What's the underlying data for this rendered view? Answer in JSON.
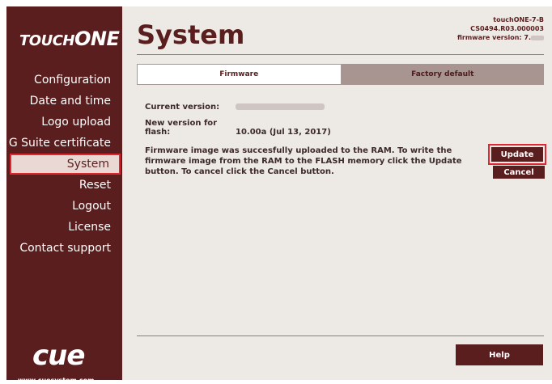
{
  "sidebar": {
    "logo_touch": "TOUCH",
    "logo_one": "ONE",
    "items": [
      {
        "label": "Configuration"
      },
      {
        "label": "Date and time"
      },
      {
        "label": "Logo upload"
      },
      {
        "label": "G Suite certificate"
      },
      {
        "label": "System"
      },
      {
        "label": "Reset"
      },
      {
        "label": "Logout"
      },
      {
        "label": "License"
      },
      {
        "label": "Contact support"
      }
    ],
    "cue_logo": "cue",
    "website": "www.cuesystem.com"
  },
  "header": {
    "title": "System",
    "device_name": "touchONE-7-B",
    "serial": "CS0494.R03.000003",
    "firmware_label": "firmware version: 7."
  },
  "tabs": [
    {
      "label": "Firmware",
      "active": true
    },
    {
      "label": "Factory default",
      "active": false
    }
  ],
  "firmware": {
    "current_version_label": "Current version:",
    "new_version_label": "New version for flash:",
    "new_version_value": "10.00a (Jul 13, 2017)",
    "message": "Firmware image was succesfully uploaded to the RAM. To write the firmware image from the RAM to the FLASH memory click the Update button. To cancel click the Cancel button."
  },
  "buttons": {
    "update": "Update",
    "cancel": "Cancel",
    "help": "Help"
  },
  "colors": {
    "brand": "#5a1e1e",
    "panel": "#ede9e5",
    "highlight": "#e0262f"
  }
}
